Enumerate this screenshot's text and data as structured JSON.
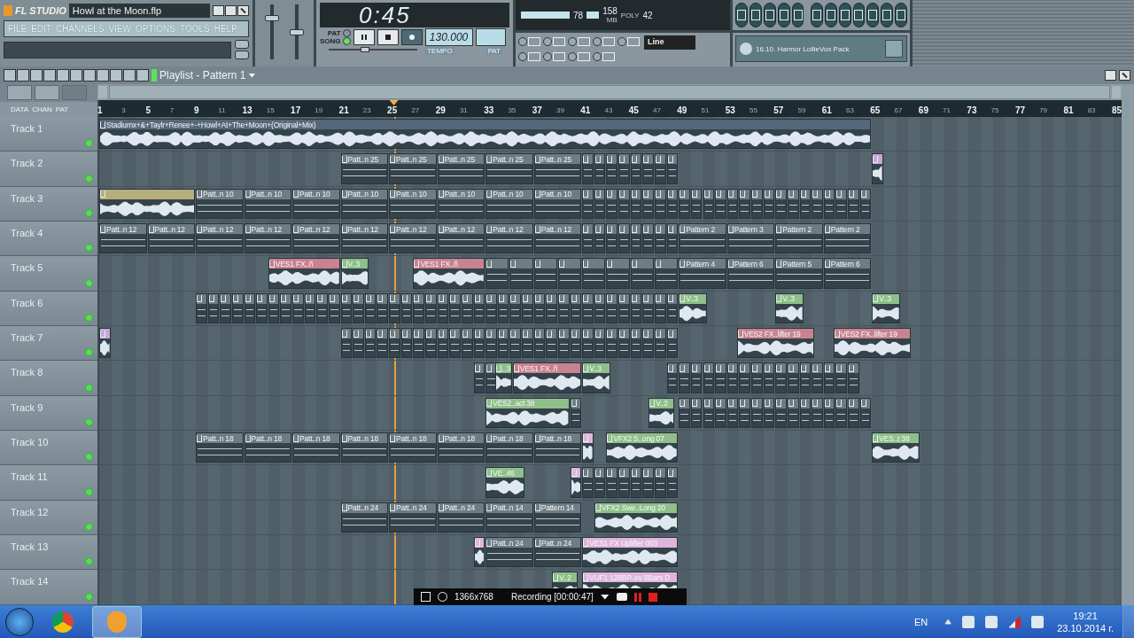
{
  "app": {
    "logo": "FL STUDIO",
    "project": "Howl at the Moon.flp",
    "menu": [
      "FILE",
      "EDIT",
      "CHANNELS",
      "VIEW",
      "OPTIONS",
      "TOOLS",
      "HELP"
    ],
    "master_volume": {
      "level": 0.78
    },
    "master_pitch": {
      "level": 0.5
    },
    "modes": [
      {
        "label": "PAT",
        "selected": false
      },
      {
        "label": "SONG",
        "selected": true
      }
    ],
    "song_position": {
      "level": 0.4
    },
    "time": "0:45",
    "tempo": "130.000",
    "tempo_label": "TEMPO",
    "pattern_label": "PAT",
    "cpu": "78",
    "memory": "158",
    "memory_unit": "MB",
    "poly_label": "POLY",
    "poly": "42",
    "snap": "Line",
    "browser_item": "16.10. Harmor LollieVox Pack"
  },
  "playlist": {
    "title": "Playlist - Pattern 1",
    "view_tabs": [
      "DATA",
      "CHAN",
      "PAT"
    ],
    "ruler": [
      "1",
      "3",
      "5",
      "7",
      "9",
      "11",
      "13",
      "15",
      "17",
      "19",
      "21",
      "23",
      "25",
      "27",
      "29",
      "31",
      "33",
      "35",
      "37",
      "39",
      "41",
      "43",
      "45",
      "47",
      "49",
      "51",
      "53",
      "55",
      "57",
      "59",
      "61",
      "63",
      "65",
      "67",
      "69",
      "71",
      "73",
      "75",
      "77",
      "79",
      "81",
      "83",
      "85"
    ],
    "tracks": [
      {
        "name": "Track 1",
        "clips": [
          {
            "kind": "audio",
            "label": "Stadiumx+&+Taylr+Renee+-+Howl+At+The+Moon+(Original+Mix)",
            "color": "#55687a"
          }
        ]
      },
      {
        "name": "Track 2",
        "clips": [
          {
            "kind": "pattern",
            "label": "Patt..n 25"
          },
          {
            "kind": "pattern",
            "label": "Patt..n 25"
          },
          {
            "kind": "pattern",
            "label": "Patt..n 25"
          },
          {
            "kind": "pattern",
            "label": "Patt..n 25"
          },
          {
            "kind": "pattern",
            "label": "Patt..n 25"
          },
          {
            "kind": "run"
          },
          {
            "kind": "audio",
            "color": "#c8a8da"
          }
        ]
      },
      {
        "name": "Track 3",
        "clips": [
          {
            "kind": "audio",
            "color": "#b8ad7c"
          },
          {
            "kind": "pattern",
            "label": "Patt..n 10"
          },
          {
            "kind": "pattern",
            "label": "Patt..n 10"
          },
          {
            "kind": "pattern",
            "label": "Patt..n 10"
          },
          {
            "kind": "pattern",
            "label": "Patt..n 10"
          },
          {
            "kind": "pattern",
            "label": "Patt..n 10"
          },
          {
            "kind": "pattern",
            "label": "Patt..n 10"
          },
          {
            "kind": "pattern",
            "label": "Patt..n 10"
          },
          {
            "kind": "pattern",
            "label": "Patt..n 10"
          },
          {
            "kind": "run"
          },
          {
            "kind": "run"
          },
          {
            "kind": "run"
          }
        ]
      },
      {
        "name": "Track 4",
        "clips": [
          {
            "kind": "pattern",
            "label": "Patt..n 12"
          },
          {
            "kind": "pattern",
            "label": "Patt..n 12"
          },
          {
            "kind": "pattern",
            "label": "Patt..n 12"
          },
          {
            "kind": "pattern",
            "label": "Patt..n 12"
          },
          {
            "kind": "pattern",
            "label": "Patt..n 12"
          },
          {
            "kind": "pattern",
            "label": "Patt..n 12"
          },
          {
            "kind": "pattern",
            "label": "Patt..n 12"
          },
          {
            "kind": "pattern",
            "label": "Patt..n 12"
          },
          {
            "kind": "pattern",
            "label": "Patt..n 12"
          },
          {
            "kind": "pattern",
            "label": "Patt..n 12"
          },
          {
            "kind": "run"
          },
          {
            "kind": "pattern",
            "label": "Pattern 2"
          },
          {
            "kind": "pattern",
            "label": "Pattern 3"
          },
          {
            "kind": "pattern",
            "label": "Pattern 2"
          },
          {
            "kind": "pattern",
            "label": "Pattern 2"
          }
        ]
      },
      {
        "name": "Track 5",
        "clips": [
          {
            "kind": "audio",
            "label": "VES1 FX..ñ",
            "color": "#c9828f"
          },
          {
            "kind": "audio",
            "label": "V..3",
            "color": "#8fbf8a"
          },
          {
            "kind": "audio",
            "label": "VES1 FX..ñ",
            "color": "#c9828f"
          },
          {
            "kind": "run"
          },
          {
            "kind": "pattern",
            "label": "Pattern 4"
          },
          {
            "kind": "pattern",
            "label": "Pattern 6"
          },
          {
            "kind": "pattern",
            "label": "Pattern 5"
          },
          {
            "kind": "pattern",
            "label": "Pattern 6"
          }
        ]
      },
      {
        "name": "Track 6",
        "clips": [
          {
            "kind": "run"
          },
          {
            "kind": "audio",
            "label": "V..3",
            "color": "#8fbf8a"
          },
          {
            "kind": "audio",
            "label": "V..3",
            "color": "#8fbf8a"
          },
          {
            "kind": "audio",
            "label": "V..3",
            "color": "#8fbf8a"
          }
        ]
      },
      {
        "name": "Track 7",
        "clips": [
          {
            "kind": "audio",
            "color": "#c8a8da"
          },
          {
            "kind": "run"
          },
          {
            "kind": "audio",
            "label": "VES2 FX..lifter 19",
            "color": "#c9828f"
          },
          {
            "kind": "audio",
            "label": "VES2 FX..lifter 19",
            "color": "#c9828f"
          }
        ]
      },
      {
        "name": "Track 8",
        "clips": [
          {
            "kind": "run"
          },
          {
            "kind": "audio",
            "label": "..3",
            "color": "#8fbf8a"
          },
          {
            "kind": "audio",
            "label": "VES1 FX..ñ",
            "color": "#c9828f"
          },
          {
            "kind": "audio",
            "label": "V..3",
            "color": "#8fbf8a"
          },
          {
            "kind": "run"
          }
        ]
      },
      {
        "name": "Track 9",
        "clips": [
          {
            "kind": "audio",
            "label": "VES2..act 38",
            "color": "#8fbf8a"
          },
          {
            "kind": "run"
          },
          {
            "kind": "audio",
            "label": "V..2",
            "color": "#8fbf8a"
          },
          {
            "kind": "run"
          },
          {
            "kind": "run"
          }
        ]
      },
      {
        "name": "Track 10",
        "clips": [
          {
            "kind": "pattern",
            "label": "Patt..n 18"
          },
          {
            "kind": "pattern",
            "label": "Patt..n 18"
          },
          {
            "kind": "pattern",
            "label": "Patt..n 18"
          },
          {
            "kind": "pattern",
            "label": "Patt..n 18"
          },
          {
            "kind": "pattern",
            "label": "Patt..n 18"
          },
          {
            "kind": "pattern",
            "label": "Patt..n 18"
          },
          {
            "kind": "pattern",
            "label": "Patt..n 18"
          },
          {
            "kind": "pattern",
            "label": "Patt..n 18"
          },
          {
            "kind": "audio",
            "color": "#e0b4dc"
          },
          {
            "kind": "audio",
            "label": "VFX2 S..ong 07",
            "color": "#8fbf8a"
          },
          {
            "kind": "audio",
            "label": "VES..t 38",
            "color": "#8fbf8a"
          }
        ]
      },
      {
        "name": "Track 11",
        "clips": [
          {
            "kind": "audio",
            "label": "VE..46",
            "color": "#8fbf8a"
          },
          {
            "kind": "audio",
            "color": "#e0b4dc"
          },
          {
            "kind": "run"
          }
        ]
      },
      {
        "name": "Track 12",
        "clips": [
          {
            "kind": "pattern",
            "label": "Patt..n 24"
          },
          {
            "kind": "pattern",
            "label": "Patt..n 24"
          },
          {
            "kind": "pattern",
            "label": "Patt..n 24"
          },
          {
            "kind": "pattern",
            "label": "Patt..n 14"
          },
          {
            "kind": "pattern",
            "label": "Pattern 14"
          },
          {
            "kind": "audio",
            "label": "VFX2 Swe..Long 20",
            "color": "#8fbf8a"
          }
        ]
      },
      {
        "name": "Track 13",
        "clips": [
          {
            "kind": "audio",
            "color": "#e0b4dc"
          },
          {
            "kind": "pattern",
            "label": "Patt..n 24"
          },
          {
            "kind": "pattern",
            "label": "Patt..n 24"
          },
          {
            "kind": "audio",
            "label": "VES1 FX Uplifter 003",
            "color": "#e0b4dc"
          }
        ]
      },
      {
        "name": "Track 14",
        "clips": [
          {
            "kind": "audio",
            "label": "V..2",
            "color": "#8fbf8a"
          },
          {
            "kind": "audio",
            "label": "VUF1 128BP..ev 8Bars D",
            "color": "#e0b4dc"
          }
        ]
      }
    ]
  },
  "recorder": {
    "resolution": "1366x768",
    "status": "Recording [00:00:47]"
  },
  "taskbar": {
    "language": "EN",
    "time": "19:21",
    "date": "23.10.2014 г."
  }
}
